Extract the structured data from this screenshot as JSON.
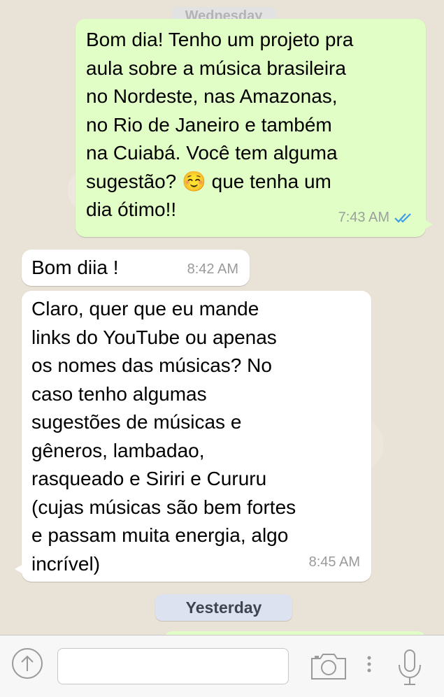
{
  "chat": {
    "day_label_top": "Wednesday",
    "messages": [
      {
        "direction": "out",
        "text": "Bom dia! Tenho um projeto pra\naula sobre a música brasileira\nno Nordeste, nas Amazonas,\nno Rio de Janeiro e também\nna Cuiabá. Você tem alguma\nsugestão? ☺️ que tenha um\ndia ótimo!!",
        "time": "7:43 AM",
        "status": "read-double-check"
      },
      {
        "direction": "in",
        "text": "Bom diia !",
        "time": "8:42 AM"
      },
      {
        "direction": "in",
        "text": "Claro, quer que eu mande\nlinks do YouTube ou apenas\nos nomes das músicas? No\ncaso tenho algumas\nsugestões de músicas e\ngêneros, lambadao,\nrasqueado e Siriri e Cururu\n(cujas músicas são bem fortes\ne passam muita energia, algo\nincrível)",
        "time": "8:45 AM"
      }
    ],
    "date_separator": "Yesterday"
  },
  "input_bar": {
    "message_value": "",
    "message_placeholder": ""
  },
  "colors": {
    "outgoing_bubble": "#e1fec6",
    "incoming_bubble": "#ffffff",
    "read_check": "#3d9ce8",
    "wallpaper": "#e9e2d6"
  },
  "icons": {
    "upload": "upload-arrow-icon",
    "camera": "camera-icon",
    "more": "more-vertical-icon",
    "mic": "microphone-icon",
    "read": "double-check-icon"
  }
}
